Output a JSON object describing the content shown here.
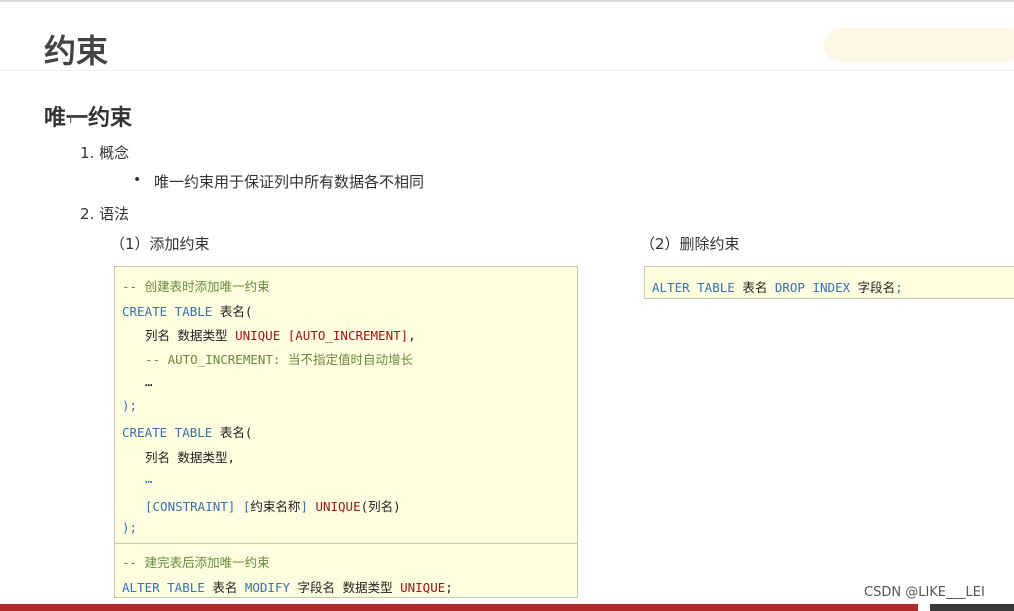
{
  "slide": {
    "title": "约束",
    "section_title": "唯一约束",
    "items": {
      "concept_label": "1. 概念",
      "concept_bullet": "唯一约束用于保证列中所有数据各不相同",
      "syntax_label": "2. 语法",
      "add_label": "（1）添加约束",
      "drop_label": "（2）删除约束"
    }
  },
  "code_add": {
    "l1": "-- 创建表时添加唯一约束",
    "l2a": "CREATE TABLE",
    "l2b": " 表名(",
    "l3a": "列名 数据类型 ",
    "l3b": "UNIQUE [AUTO_INCREMENT]",
    "l3c": ",",
    "l4": "-- AUTO_INCREMENT: 当不指定值时自动增长",
    "l5": "…",
    "l6": ");",
    "l7a": "CREATE TABLE",
    "l7b": " 表名(",
    "l8": "列名 数据类型,",
    "l9": "…",
    "l10a": "[CONSTRAINT] [",
    "l10b": "约束名称",
    "l10c": "] ",
    "l10d": "UNIQUE",
    "l10e": "(列名)",
    "l11": ");",
    "l12": "-- 建完表后添加唯一约束",
    "l13a": "ALTER TABLE",
    "l13b": " 表名 ",
    "l13c": "MODIFY",
    "l13d": " 字段名 数据类型 ",
    "l13e": "UNIQUE",
    "l13f": ";"
  },
  "code_drop": {
    "a": "ALTER TABLE",
    "b": " 表名 ",
    "c": "DROP INDEX",
    "d": " 字段名",
    "e": ";"
  },
  "watermark": "CSDN @LIKE___LEI",
  "colors": {
    "keyword": "#3b6fb6",
    "comment": "#6a8a3c",
    "constraint": "#a31515",
    "code_bg": "#fdfde0",
    "accent_bar": "#b12a2a"
  }
}
